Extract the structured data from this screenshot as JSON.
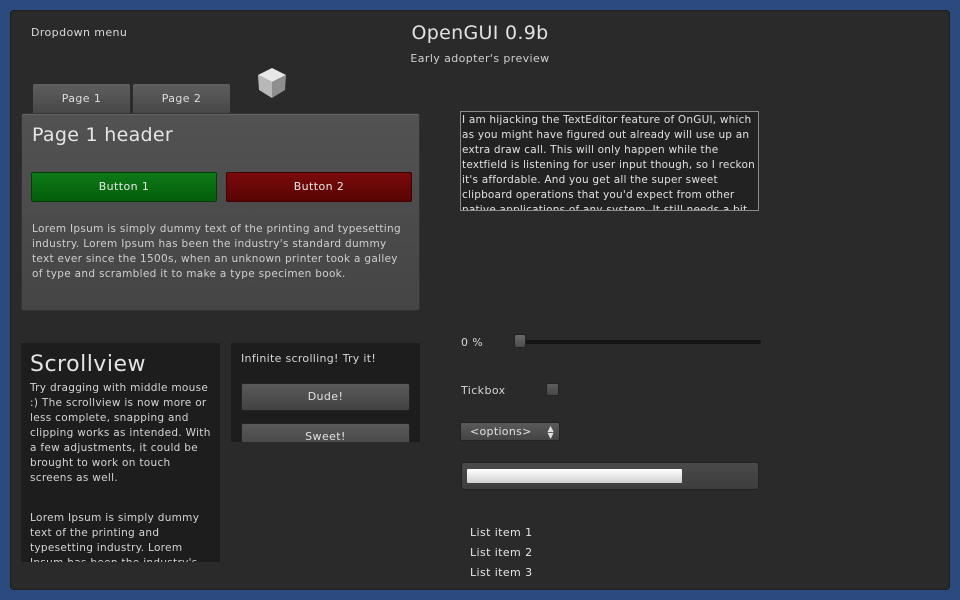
{
  "menu": {
    "dropdown_label": "Dropdown menu"
  },
  "header": {
    "title": "OpenGUI 0.9b",
    "subtitle": "Early adopter's preview"
  },
  "tabs": [
    {
      "label": "Page 1"
    },
    {
      "label": "Page 2"
    }
  ],
  "page1": {
    "header": "Page 1 header",
    "button1": "Button 1",
    "button2": "Button 2",
    "body": "Lorem Ipsum is simply dummy text of the printing and typesetting industry. Lorem Ipsum has been the industry's standard dummy text ever since the 1500s, when an unknown printer took a galley of type and scrambled it to make a type specimen book."
  },
  "scrollview": {
    "title": "Scrollview",
    "text1": "Try dragging with middle mouse :) The scrollview is now more or less complete, snapping and clipping works as intended. With a few adjustments, it could be brought to work on touch screens as well.",
    "text2": "Lorem Ipsum is simply dummy text of the printing and typesetting industry. Lorem Ipsum has been the industry's standard dummy text"
  },
  "infinite": {
    "label": "Infinite scrolling! Try it!",
    "buttons": [
      "Dude!",
      "Sweet!"
    ]
  },
  "texteditor": {
    "text": "I am hijacking the TextEditor feature of OnGUI, which as you might have figured out already will use up an extra draw call. This will only happen while the textfield is listening for user input though, so I reckon it's affordable. And you get all the super sweet clipboard operations that you'd expect from other native applications of any system. It still needs a bit of polish though."
  },
  "slider": {
    "value_label": "0 %",
    "value": 0
  },
  "tickbox": {
    "label": "Tickbox",
    "checked": false
  },
  "dropdown_select": {
    "selected": "<options>",
    "arrow_icon": "chevron-up-down-icon"
  },
  "progress": {
    "value": 0.75
  },
  "list": {
    "items": [
      "List item 1",
      "List item 2",
      "List item 3"
    ]
  },
  "colors": {
    "background": "#2a2a2a",
    "frame": "#2c4a7e",
    "button1": "#0d7a17",
    "button2": "#7a0a0a"
  }
}
